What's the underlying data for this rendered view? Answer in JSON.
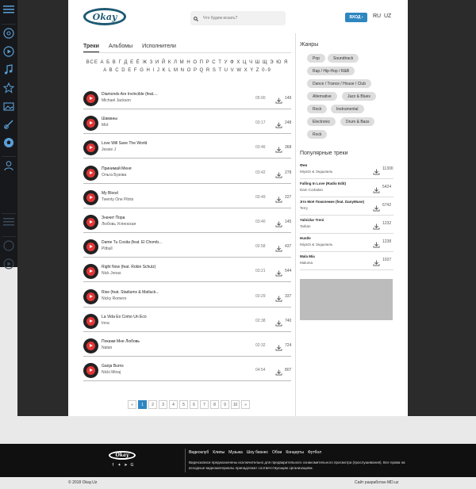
{
  "header": {
    "logo_text": "Okay",
    "search_placeholder": "Что будем искать?",
    "login_label": "ВХОД ›",
    "lang_ru": "RU",
    "lang_uz": "UZ"
  },
  "tabs": [
    "Треки",
    "Альбомы",
    "Исполнители"
  ],
  "alphabet_cyr": "ВСЕ А Б В Г Д Е Ё Ж З И Й К Л М Н О П Р С Т У Ф Х Ц Ч Ш Щ Э Ю Я",
  "alphabet_lat": "A B C D E F G H I J K L M N O P Q R S T U V W X Y Z 0-9",
  "tracks": [
    {
      "title": "Diamonds Are Invincible (feat....",
      "artist": "Michael Jackson",
      "duration": "05:00",
      "downloads": "149"
    },
    {
      "title": "Шаманы",
      "artist": "Mot",
      "duration": "03:17",
      "downloads": "248"
    },
    {
      "title": "Love Will Save The World",
      "artist": "Jessie J",
      "duration": "03:46",
      "downloads": "368"
    },
    {
      "title": "Принимай Меня",
      "artist": "Ольга Бузова",
      "duration": "03:42",
      "downloads": "278"
    },
    {
      "title": "My Blood",
      "artist": "Twenty One Pilots",
      "duration": "03:49",
      "downloads": "227"
    },
    {
      "title": "Значит Пора",
      "artist": "Любовь Успенская",
      "duration": "03:40",
      "downloads": "145"
    },
    {
      "title": "Dame Tu Cosita (feat. El Chomb...",
      "artist": "Pitbull",
      "duration": "02:58",
      "downloads": "437"
    },
    {
      "title": "Right Now (feat. Robin Schulz)",
      "artist": "Nick Jonas",
      "duration": "03:21",
      "downloads": "544"
    },
    {
      "title": "Rise (feat. Stadiumx & Matluck...",
      "artist": "Nicky Romero",
      "duration": "03:29",
      "downloads": "337"
    },
    {
      "title": "La Vida Es Como Un Eco",
      "artist": "Inna",
      "duration": "02:38",
      "downloads": "740"
    },
    {
      "title": "Покажи Мне Любовь",
      "artist": "Natan",
      "duration": "02:32",
      "downloads": "724"
    },
    {
      "title": "Ganja Burns",
      "artist": "Nicki Minaj",
      "duration": "04:54",
      "downloads": "807"
    }
  ],
  "pagination": [
    "«",
    "1",
    "2",
    "3",
    "4",
    "5",
    "6",
    "7",
    "8",
    "9",
    "10",
    "»"
  ],
  "sidebar": {
    "genres_title": "Жанры",
    "genres": [
      "Pop",
      "Soundtrack",
      "Rap / Hip-Hop / R&B",
      "Dance / Trance / House / Club",
      "Alternative",
      "Jazz & Blues",
      "Rock",
      "Instrumental",
      "Electronic",
      "Drum & Bass",
      "Rock"
    ],
    "popular_title": "Популярные треки",
    "popular": [
      {
        "title": "Фея",
        "artist": "MiyaGi & Эндшпиль",
        "count": "11300"
      },
      {
        "title": "Falling In Love (Radio Edit)",
        "artist": "Dam Corbalan",
        "count": "5424"
      },
      {
        "title": "Это Моё Поколение (feat. DanyMuse)",
        "artist": "Terry",
        "count": "6742"
      },
      {
        "title": "Yalnizlar Treni",
        "artist": "Tarkan",
        "count": "1232"
      },
      {
        "title": "Hustle",
        "artist": "MiyaGi & Эндшпиль",
        "count": "1238"
      },
      {
        "title": "Mala Mia",
        "artist": "Maluma",
        "count": "1037"
      }
    ]
  },
  "footer": {
    "logo_text": "Okay",
    "nav": [
      "Видеоклуб",
      "Клипы",
      "Музыка",
      "Шоу бизнес",
      "Обои",
      "Концерты",
      "Футбол"
    ],
    "disclaimer": "Видеозаписи предназначены исключительно для предварительного ознакомительного просмотра (прослушивания). Все права на исходные видеоматериалы принадлежат соответствующим организациям.",
    "copyright": "© 2018 Okay.Uz",
    "developer": "Сайт разработан MD.uz"
  },
  "colors": {
    "accent": "#2e86c1",
    "play_red": "#e23636",
    "dark": "#17181b"
  }
}
